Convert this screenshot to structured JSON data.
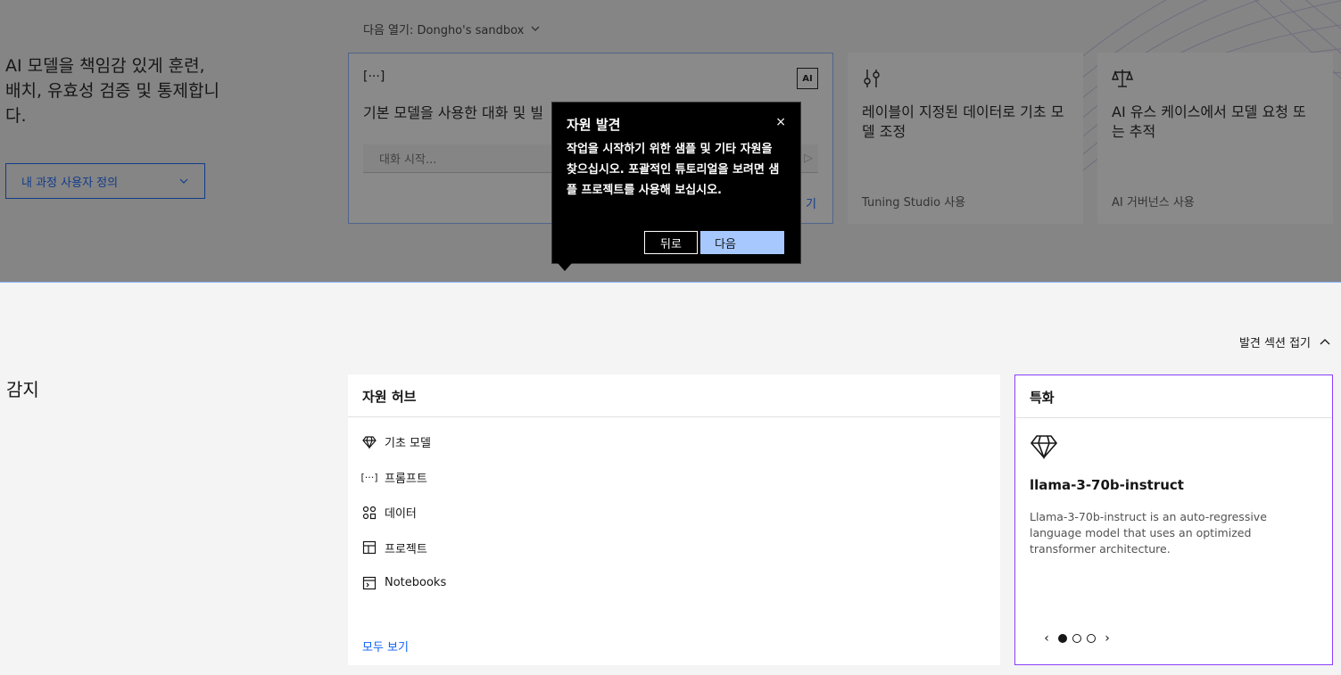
{
  "hero": {
    "intro": "AI 모델을 책임감 있게 훈련, 배치, 유효성 검증 및 통제합니다.",
    "customize_label": "내 과정 사용자 정의",
    "workspace_label": "다음 열기: Dongho's sandbox"
  },
  "cards": {
    "chat": {
      "title": "기본 모델을 사용한 대화 및 빌",
      "badge": "AI",
      "input_placeholder": "대화 시작...",
      "send": "▷",
      "link": "기"
    },
    "tune": {
      "title": "레이블이 지정된 데이터로 기초 모델 조정",
      "footer": "Tuning Studio 사용"
    },
    "gov": {
      "title": "AI 유스 케이스에서 모델 요청 또는 추적",
      "footer": "AI 거버넌스 사용"
    }
  },
  "popover": {
    "title": "자원 발견",
    "close": "×",
    "body": "작업을 시작하기 위한 샘플 및 기타 자원을 찾으십시오. 포괄적인 튜토리얼을 보려면 샘플 프로젝트를 사용해 보십시오.",
    "back_label": "뒤로",
    "next_label": "다음"
  },
  "discover": {
    "collapse_label": "발견 섹션 접기",
    "section_title": "감지"
  },
  "hub": {
    "title": "자원 허브",
    "items": [
      {
        "label": "기초 모델",
        "icon": "diamond-icon"
      },
      {
        "label": "프롬프트",
        "icon": "prompt-brackets-icon"
      },
      {
        "label": "데이터",
        "icon": "data-icon"
      },
      {
        "label": "프로젝트",
        "icon": "project-icon"
      },
      {
        "label": "Notebooks",
        "icon": "notebook-icon"
      }
    ],
    "view_all": "모두 보기"
  },
  "featured": {
    "title": "특화",
    "model_name": "llama-3-70b-instruct",
    "description": "Llama-3-70b-instruct is an auto-regressive language model that uses an optimized transformer architecture.",
    "prev": "‹",
    "next": "›"
  },
  "colors": {
    "accent": "#0f62fe",
    "featured_border": "#8a3ffc",
    "next_button": "#a6c8ff"
  }
}
